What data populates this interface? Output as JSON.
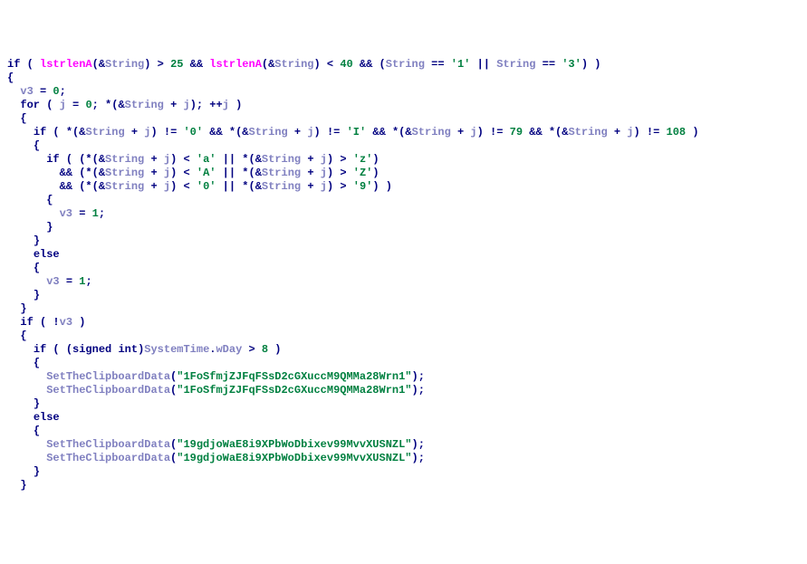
{
  "code": {
    "kw_if": "if",
    "kw_for": "for",
    "kw_else": "else",
    "kw_signed": "signed",
    "kw_int": "int",
    "fn_lstrlenA": "lstrlenA",
    "id_String": "String",
    "id_SystemTime": "SystemTime",
    "id_wDay": "wDay",
    "fn_SetTheClipboardData": "SetTheClipboardData",
    "v_v3": "v3",
    "v_j": "j",
    "lit_0": "0",
    "lit_1": "1",
    "lit_8": "8",
    "lit_25": "25",
    "lit_40": "40",
    "lit_79": "79",
    "lit_108": "108",
    "ch_0": "'0'",
    "ch_I": "'I'",
    "ch_1": "'1'",
    "ch_3": "'3'",
    "ch_a": "'a'",
    "ch_z": "'z'",
    "ch_A": "'A'",
    "ch_Z": "'Z'",
    "ch_9": "'9'",
    "str_clip1": "\"1FoSfmjZJFqFSsD2cGXuccM9QMMa28Wrn1\"",
    "str_clip2": "\"19gdjoWaE8i9XPbWoDbixev99MvvXUSNZL\""
  }
}
